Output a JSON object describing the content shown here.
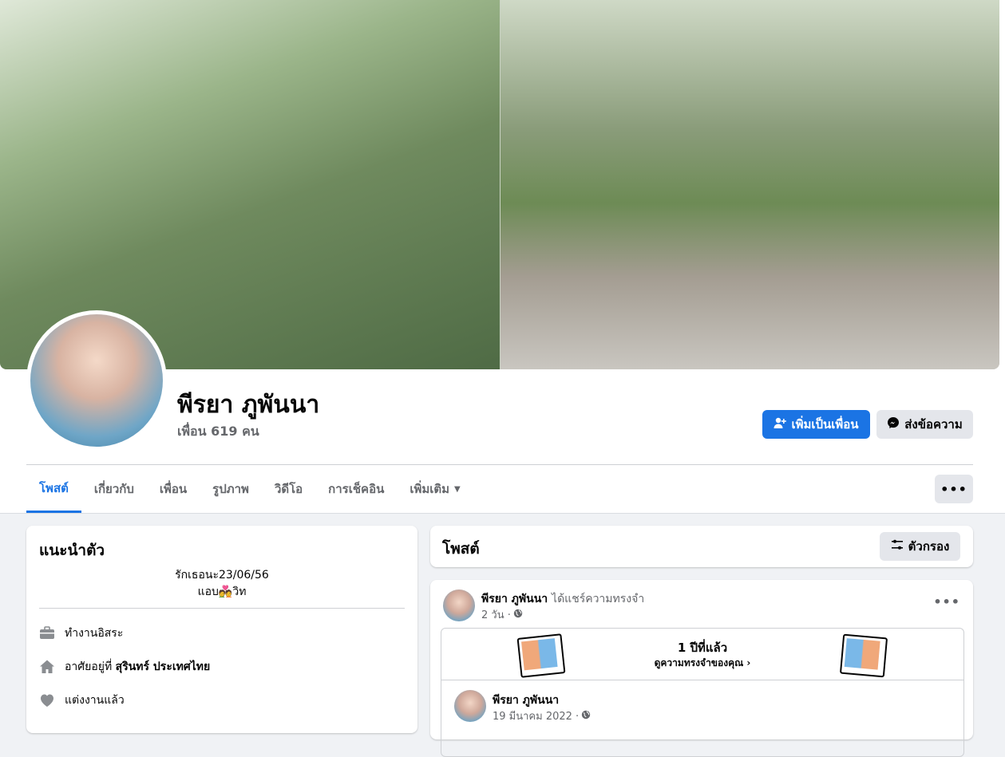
{
  "profile": {
    "name": "พีรยา ภูพันนา",
    "friends_count": "เพื่อน 619 คน"
  },
  "actions": {
    "add_friend": "เพิ่มเป็นเพื่อน",
    "message": "ส่งข้อความ"
  },
  "tabs": [
    {
      "label": "โพสต์",
      "active": true
    },
    {
      "label": "เกี่ยวกับ"
    },
    {
      "label": "เพื่อน"
    },
    {
      "label": "รูปภาพ"
    },
    {
      "label": "วิดีโอ"
    },
    {
      "label": "การเช็คอิน"
    },
    {
      "label": "เพิ่มเติม"
    }
  ],
  "intro": {
    "title": "แนะนำตัว",
    "bio_line1": "รักเธอนะ23/06/56",
    "bio_line2": "แอบ💑วิท",
    "work": "ทำงานอิสระ",
    "lives_prefix": "อาศัยอยู่ที่ ",
    "lives_place": "สุรินทร์ ประเทศไทย",
    "relationship": "แต่งงานแล้ว"
  },
  "posts": {
    "title": "โพสต์",
    "filter_label": "ตัวกรอง"
  },
  "post": {
    "author": "พีรยา ภูพันนา",
    "action": "ได้แชร์ความทรงจำ",
    "time": "2 วัน ·",
    "memory_title": "1 ปีที่แล้ว",
    "memory_sub": "ดูความทรงจำของคุณ",
    "orig_author": "พีรยา ภูพันนา",
    "orig_time": "19 มีนาคม 2022 ·"
  },
  "colors": {
    "accent": "#1b74e4",
    "secondary_bg": "#e4e6eb",
    "page_bg": "#f0f2f5",
    "muted_text": "#65676b"
  }
}
